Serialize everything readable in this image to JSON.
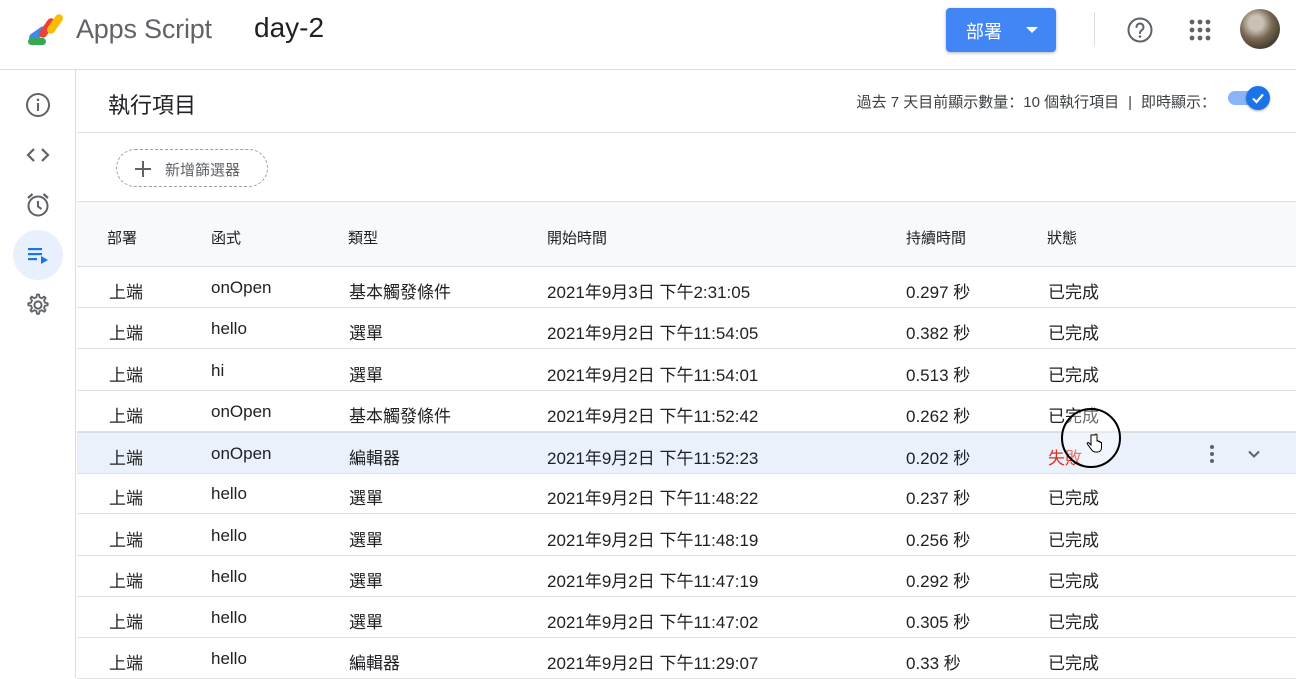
{
  "header": {
    "app_name": "Apps Script",
    "project_name": "day-2",
    "deploy_label": "部署",
    "icons": [
      "apps-script-logo-icon",
      "caret-down-icon",
      "help-icon",
      "apps-grid-icon",
      "avatar"
    ]
  },
  "sidebar": {
    "items": [
      {
        "name": "overview",
        "icon": "info-icon"
      },
      {
        "name": "editor",
        "icon": "code-icon"
      },
      {
        "name": "triggers",
        "icon": "alarm-icon"
      },
      {
        "name": "executions",
        "icon": "executions-icon",
        "active": true
      },
      {
        "name": "settings",
        "icon": "gear-icon"
      }
    ]
  },
  "page": {
    "title": "執行項目",
    "summary": "過去 7 天目前顯示數量：10 個執行項目",
    "separator": "|",
    "live_label": "即時顯示：",
    "live_enabled": true,
    "filter_label": "新增篩選器"
  },
  "table": {
    "headers": [
      "部署",
      "函式",
      "類型",
      "開始時間",
      "持續時間",
      "狀態"
    ],
    "rows": [
      {
        "deployment": "上端",
        "function": "onOpen",
        "type": "基本觸發條件",
        "start": "2021年9月3日 下午2:31:05",
        "duration": "0.297 秒",
        "status": "已完成"
      },
      {
        "deployment": "上端",
        "function": "hello",
        "type": "選單",
        "start": "2021年9月2日 下午11:54:05",
        "duration": "0.382 秒",
        "status": "已完成"
      },
      {
        "deployment": "上端",
        "function": "hi",
        "type": "選單",
        "start": "2021年9月2日 下午11:54:01",
        "duration": "0.513 秒",
        "status": "已完成"
      },
      {
        "deployment": "上端",
        "function": "onOpen",
        "type": "基本觸發條件",
        "start": "2021年9月2日 下午11:52:42",
        "duration": "0.262 秒",
        "status": "已完成"
      },
      {
        "deployment": "上端",
        "function": "onOpen",
        "type": "編輯器",
        "start": "2021年9月2日 下午11:52:23",
        "duration": "0.202 秒",
        "status": "失敗"
      },
      {
        "deployment": "上端",
        "function": "hello",
        "type": "選單",
        "start": "2021年9月2日 下午11:48:22",
        "duration": "0.237 秒",
        "status": "已完成"
      },
      {
        "deployment": "上端",
        "function": "hello",
        "type": "選單",
        "start": "2021年9月2日 下午11:48:19",
        "duration": "0.256 秒",
        "status": "已完成"
      },
      {
        "deployment": "上端",
        "function": "hello",
        "type": "選單",
        "start": "2021年9月2日 下午11:47:19",
        "duration": "0.292 秒",
        "status": "已完成"
      },
      {
        "deployment": "上端",
        "function": "hello",
        "type": "選單",
        "start": "2021年9月2日 下午11:47:02",
        "duration": "0.305 秒",
        "status": "已完成"
      },
      {
        "deployment": "上端",
        "function": "hello",
        "type": "編輯器",
        "start": "2021年9月2日 下午11:29:07",
        "duration": "0.33 秒",
        "status": "已完成"
      }
    ],
    "selected_row": 4
  },
  "colors": {
    "accent": "#4285f4",
    "failed": "#d93025",
    "selected_row": "#eaf1fb"
  }
}
